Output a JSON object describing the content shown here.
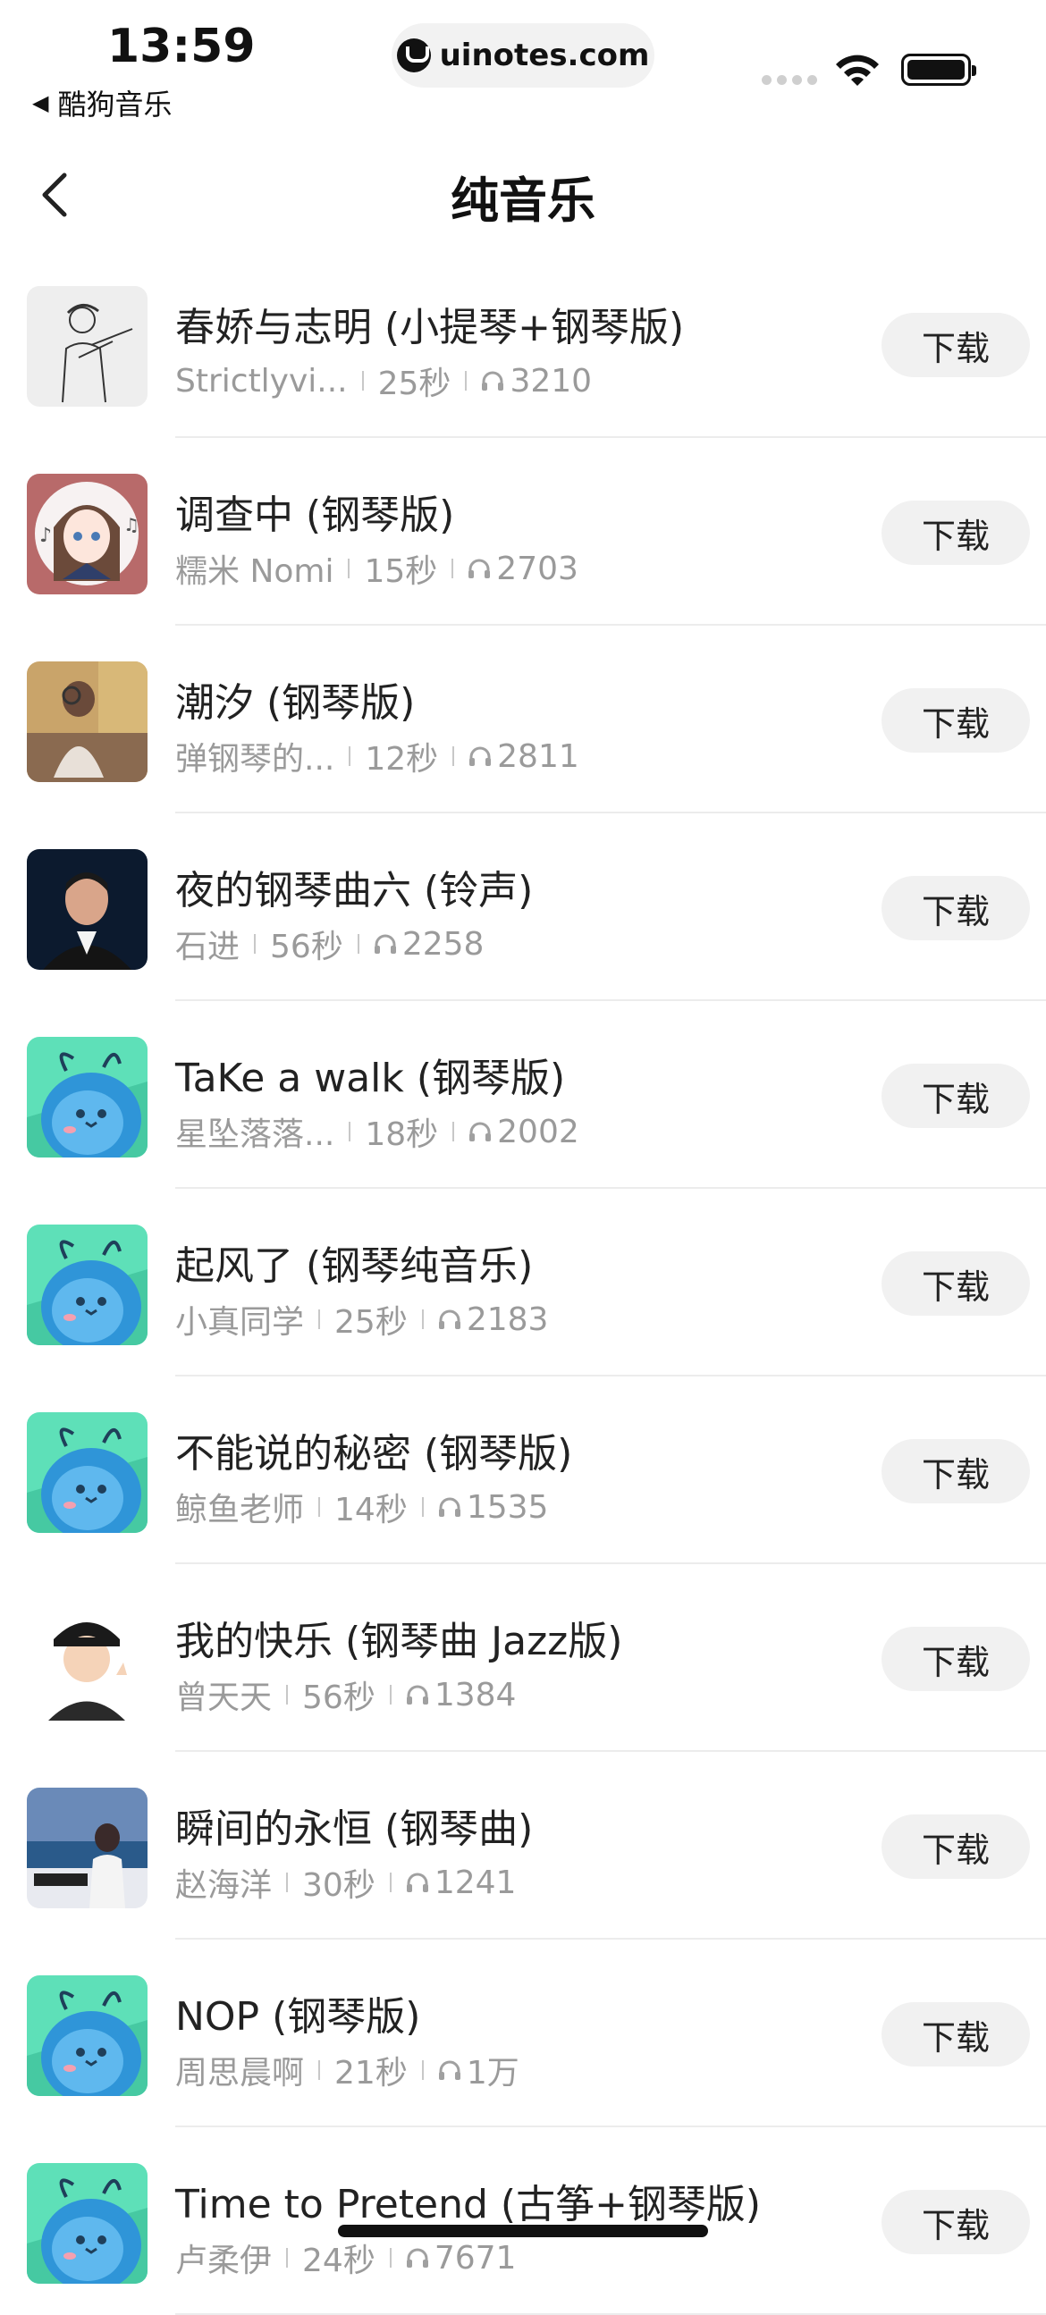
{
  "status_bar": {
    "time": "13:59",
    "back_app_label": "酷狗音乐",
    "url": "uinotes.com"
  },
  "nav": {
    "title": "纯音乐"
  },
  "list": [
    {
      "title": "春娇与志明 (小提琴+钢琴版)",
      "artist": "Strictlyvi...",
      "duration": "25秒",
      "plays": "3210",
      "cover": "sketch-violinist",
      "button": "下载"
    },
    {
      "title": "调查中 (钢琴版)",
      "artist": "糯米 Nomi",
      "duration": "15秒",
      "plays": "2703",
      "cover": "anime-girl",
      "button": "下载"
    },
    {
      "title": "潮汐 (钢琴版)",
      "artist": "弹钢琴的...",
      "duration": "12秒",
      "plays": "2811",
      "cover": "pianist-photo",
      "button": "下载"
    },
    {
      "title": "夜的钢琴曲六 (铃声)",
      "artist": "石进",
      "duration": "56秒",
      "plays": "2258",
      "cover": "portrait-man",
      "button": "下载"
    },
    {
      "title": "TaKe a walk (钢琴版)",
      "artist": "星坠落落...",
      "duration": "18秒",
      "plays": "2002",
      "cover": "blue-mascot",
      "button": "下载"
    },
    {
      "title": "起风了 (钢琴纯音乐)",
      "artist": "小真同学",
      "duration": "25秒",
      "plays": "2183",
      "cover": "blue-mascot",
      "button": "下载"
    },
    {
      "title": "不能说的秘密 (钢琴版)",
      "artist": "鲸鱼老师",
      "duration": "14秒",
      "plays": "1535",
      "cover": "blue-mascot",
      "button": "下载"
    },
    {
      "title": "我的快乐 (钢琴曲 Jazz版)",
      "artist": "曾天天",
      "duration": "56秒",
      "plays": "1384",
      "cover": "cartoon-boy",
      "button": "下载"
    },
    {
      "title": "瞬间的永恒 (钢琴曲)",
      "artist": "赵海洋",
      "duration": "30秒",
      "plays": "1241",
      "cover": "pianist-sea",
      "button": "下载"
    },
    {
      "title": "NOP (钢琴版)",
      "artist": "周思晨啊",
      "duration": "21秒",
      "plays": "1万",
      "cover": "blue-mascot",
      "button": "下载"
    },
    {
      "title": "Time to Pretend (古筝+钢琴版)",
      "artist": "卢柔伊",
      "duration": "24秒",
      "plays": "7671",
      "cover": "blue-mascot",
      "button": "下载"
    }
  ]
}
